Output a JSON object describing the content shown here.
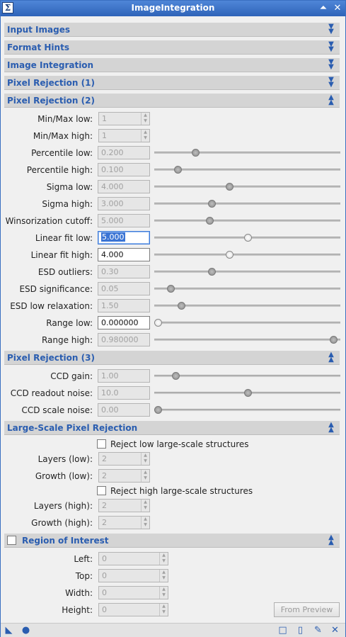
{
  "window": {
    "title": "ImageIntegration",
    "app_icon": "Σ"
  },
  "colors": {
    "accent": "#2a5db0",
    "titlebar": "#3a6fc1",
    "header_bg": "#d4d4d4"
  },
  "sections": {
    "input_images": "Input Images",
    "format_hints": "Format Hints",
    "image_integration": "Image Integration",
    "pixel_rejection_1": "Pixel Rejection (1)",
    "pixel_rejection_2": "Pixel Rejection (2)",
    "pixel_rejection_3": "Pixel Rejection (3)",
    "large_scale": "Large-Scale Pixel Rejection",
    "roi": "Region of Interest"
  },
  "pr2": {
    "minmax_low": {
      "label": "Min/Max low:",
      "value": "1"
    },
    "minmax_high": {
      "label": "Min/Max high:",
      "value": "1"
    },
    "percentile_low": {
      "label": "Percentile low:",
      "value": "0.200",
      "level": 0.21
    },
    "percentile_high": {
      "label": "Percentile high:",
      "value": "0.100",
      "level": 0.11
    },
    "sigma_low": {
      "label": "Sigma low:",
      "value": "4.000",
      "level": 0.4
    },
    "sigma_high": {
      "label": "Sigma high:",
      "value": "3.000",
      "level": 0.3
    },
    "winsor": {
      "label": "Winsorization cutoff:",
      "value": "5.000",
      "level": 0.29
    },
    "linfit_low": {
      "label": "Linear fit low:",
      "value": "5.000",
      "level": 0.5
    },
    "linfit_high": {
      "label": "Linear fit high:",
      "value": "4.000",
      "level": 0.4
    },
    "esd_outliers": {
      "label": "ESD outliers:",
      "value": "0.30",
      "level": 0.3
    },
    "esd_significance": {
      "label": "ESD significance:",
      "value": "0.05",
      "level": 0.07
    },
    "esd_low_relax": {
      "label": "ESD low relaxation:",
      "value": "1.50",
      "level": 0.13
    },
    "range_low": {
      "label": "Range low:",
      "value": "0.000000",
      "level": 0.0
    },
    "range_high": {
      "label": "Range high:",
      "value": "0.980000",
      "level": 0.98
    }
  },
  "pr3": {
    "ccd_gain": {
      "label": "CCD gain:",
      "value": "1.00",
      "level": 0.1
    },
    "ccd_readout": {
      "label": "CCD readout noise:",
      "value": "10.0",
      "level": 0.5
    },
    "ccd_scale": {
      "label": "CCD scale noise:",
      "value": "0.00",
      "level": 0.0
    }
  },
  "large_scale": {
    "reject_low_label": "Reject low large-scale structures",
    "layers_low": {
      "label": "Layers (low):",
      "value": "2"
    },
    "growth_low": {
      "label": "Growth (low):",
      "value": "2"
    },
    "reject_high_label": "Reject high large-scale structures",
    "layers_high": {
      "label": "Layers (high):",
      "value": "2"
    },
    "growth_high": {
      "label": "Growth (high):",
      "value": "2"
    }
  },
  "roi": {
    "left": {
      "label": "Left:",
      "value": "0"
    },
    "top": {
      "label": "Top:",
      "value": "0"
    },
    "width": {
      "label": "Width:",
      "value": "0"
    },
    "height": {
      "label": "Height:",
      "value": "0"
    },
    "preview_button": "From Preview"
  }
}
